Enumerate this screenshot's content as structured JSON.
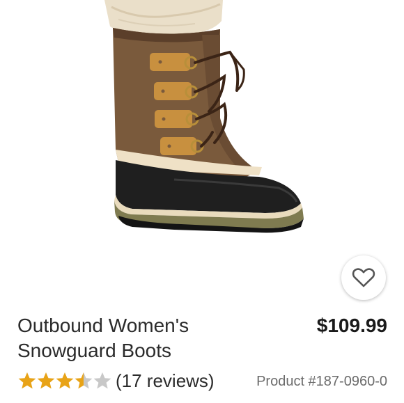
{
  "product": {
    "title_line1": "Outbound Women's",
    "title_line2": "Snowguard Boots",
    "price": "$109.99",
    "reviews": "(17 reviews)",
    "product_number": "Product #187-0960-0",
    "rating": 3.5,
    "rating_max": 5
  },
  "icons": {
    "favorite": "heart-outline-icon",
    "star": "star-icon"
  },
  "colors": {
    "star_filled": "#e8a317",
    "star_empty": "#c8c8c8",
    "heart": "#555555"
  }
}
